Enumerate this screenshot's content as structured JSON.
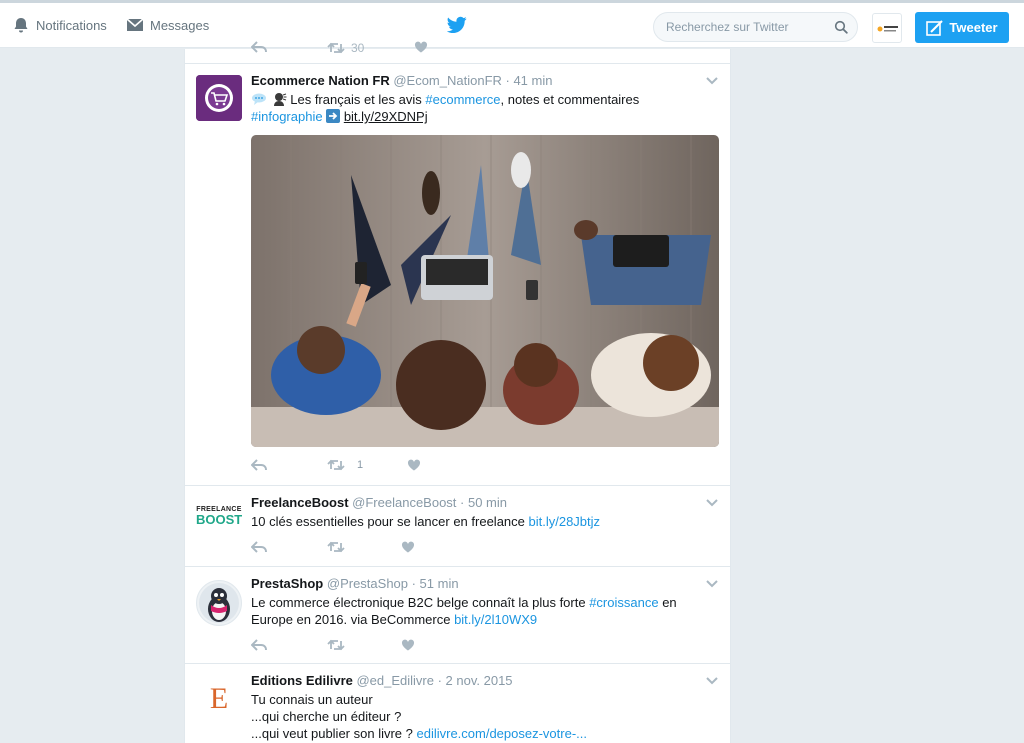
{
  "topbar": {
    "notifications_label": "Notifications",
    "messages_label": "Messages",
    "search_placeholder": "Recherchez sur Twitter",
    "tweet_button_label": "Tweeter"
  },
  "colors": {
    "accent": "#1da1f2",
    "link": "#1b95e0",
    "muted": "#8899a6",
    "icon_muted": "#aab8c2",
    "background": "#e6ecf0"
  },
  "prev_tweet": {
    "retweet_count": "30"
  },
  "tweets": [
    {
      "name": "Ecommerce Nation FR",
      "meta": "@Ecom_NationFR · 41 min",
      "text_plain": "Les français et les avis ",
      "hashtag_1": "#ecommerce",
      "text_mid": ", notes et commentaires",
      "hashtag_2": "#infographie",
      "link": "bit.ly/29XDNPj",
      "retweet_count": "1",
      "avatar_icon": "shopping-cart-icon",
      "media_icon": "photo-people-with-devices"
    },
    {
      "name": "FreelanceBoost",
      "meta": "@FreelanceBoost · 50 min",
      "text_plain": "10 clés essentielles pour se lancer en freelance ",
      "link": "bit.ly/28Jbtjz",
      "avatar_line1": "FREELANCE",
      "avatar_line2": "BOOST"
    },
    {
      "name": "PrestaShop",
      "meta": "@PrestaShop · 51 min",
      "text_plain": "Le commerce électronique B2C belge connaît la plus forte ",
      "hashtag_1": "#croissance",
      "text_mid": " en Europe en 2016. via BeCommerce ",
      "link": "bit.ly/2l10WX9",
      "avatar_icon": "penguin-icon"
    },
    {
      "name": "Editions Edilivre",
      "meta": "@ed_Edilivre · 2 nov. 2015",
      "line1": "Tu connais un auteur",
      "line2": "...qui cherche un éditeur ?",
      "line3": "...qui veut publier son livre ? ",
      "link": "edilivre.com/deposez-votre-...",
      "avatar_letter": "E"
    }
  ]
}
